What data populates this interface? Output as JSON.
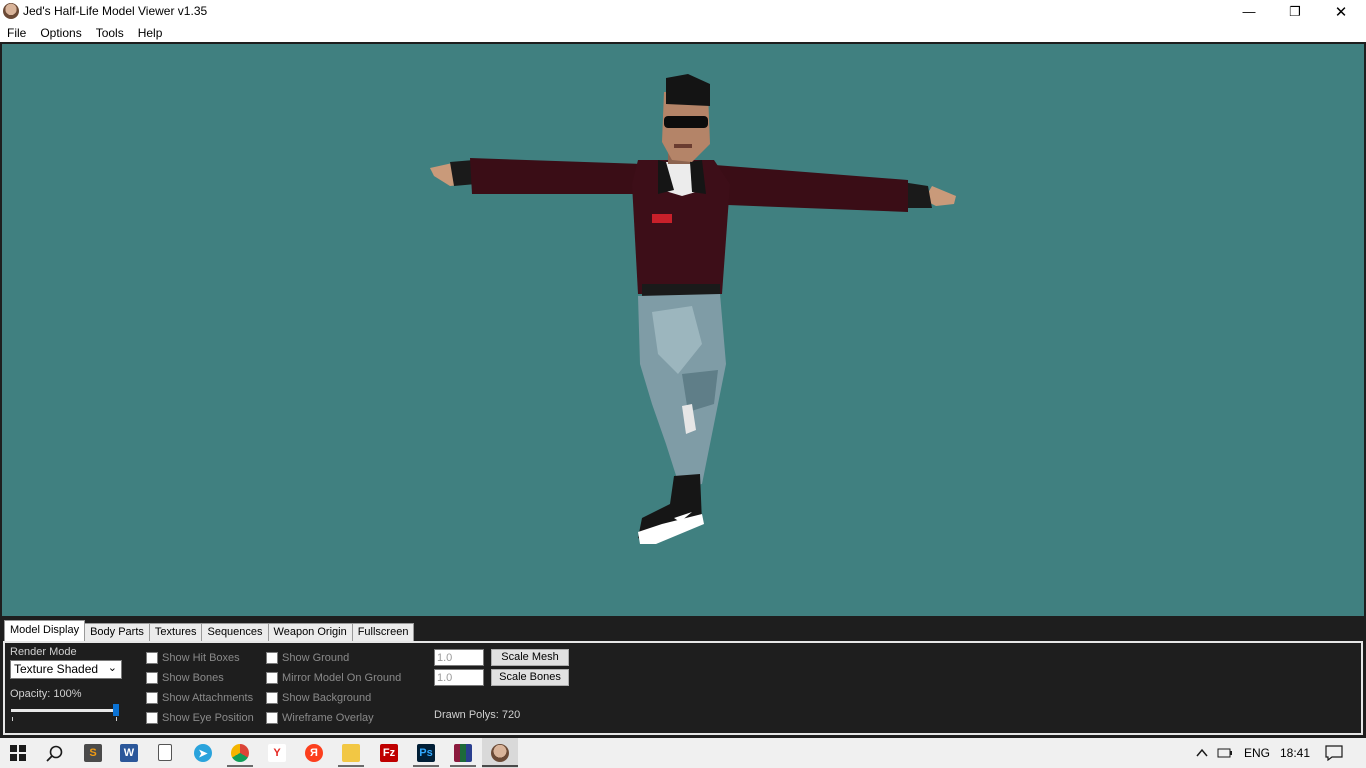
{
  "window": {
    "title": "Jed's Half-Life Model Viewer v1.35",
    "controls": {
      "minimize": "—",
      "maximize": "❐",
      "close": "✕"
    }
  },
  "menu": [
    "File",
    "Options",
    "Tools",
    "Help"
  ],
  "viewport": {
    "background": "#408080",
    "model": "t-posed player character"
  },
  "tabs": [
    {
      "label": "Model Display",
      "active": true
    },
    {
      "label": "Body Parts"
    },
    {
      "label": "Textures"
    },
    {
      "label": "Sequences"
    },
    {
      "label": "Weapon Origin"
    },
    {
      "label": "Fullscreen"
    }
  ],
  "model_display": {
    "render_mode_label": "Render Mode",
    "render_mode_value": "Texture Shaded",
    "opacity_label": "Opacity: 100%",
    "opacity_value": 1.0,
    "checkboxes_col1": [
      "Show Hit Boxes",
      "Show Bones",
      "Show Attachments",
      "Show Eye Position"
    ],
    "checkboxes_col2": [
      "Show Ground",
      "Mirror Model On Ground",
      "Show Background",
      "Wireframe Overlay"
    ],
    "scale_mesh_value": "1.0",
    "scale_mesh_button": "Scale Mesh",
    "scale_bones_value": "1.0",
    "scale_bones_button": "Scale Bones",
    "drawn_polys": "Drawn Polys: 720"
  },
  "taskbar": {
    "icons": [
      "windows-start-icon",
      "search-icon",
      "sublime-text-icon",
      "word-icon",
      "file-icon",
      "telegram-icon",
      "chrome-icon",
      "yandex-browser-icon",
      "yandex-icon",
      "file-explorer-icon",
      "filezilla-icon",
      "photoshop-icon",
      "winrar-icon",
      "hlmv-icon"
    ],
    "icon_labels": {
      "word": "W",
      "yandex": "Y",
      "yandex2": "Я",
      "filezilla": "Fz",
      "photoshop": "Ps"
    },
    "tray_language": "ENG",
    "tray_time": "18:41"
  }
}
